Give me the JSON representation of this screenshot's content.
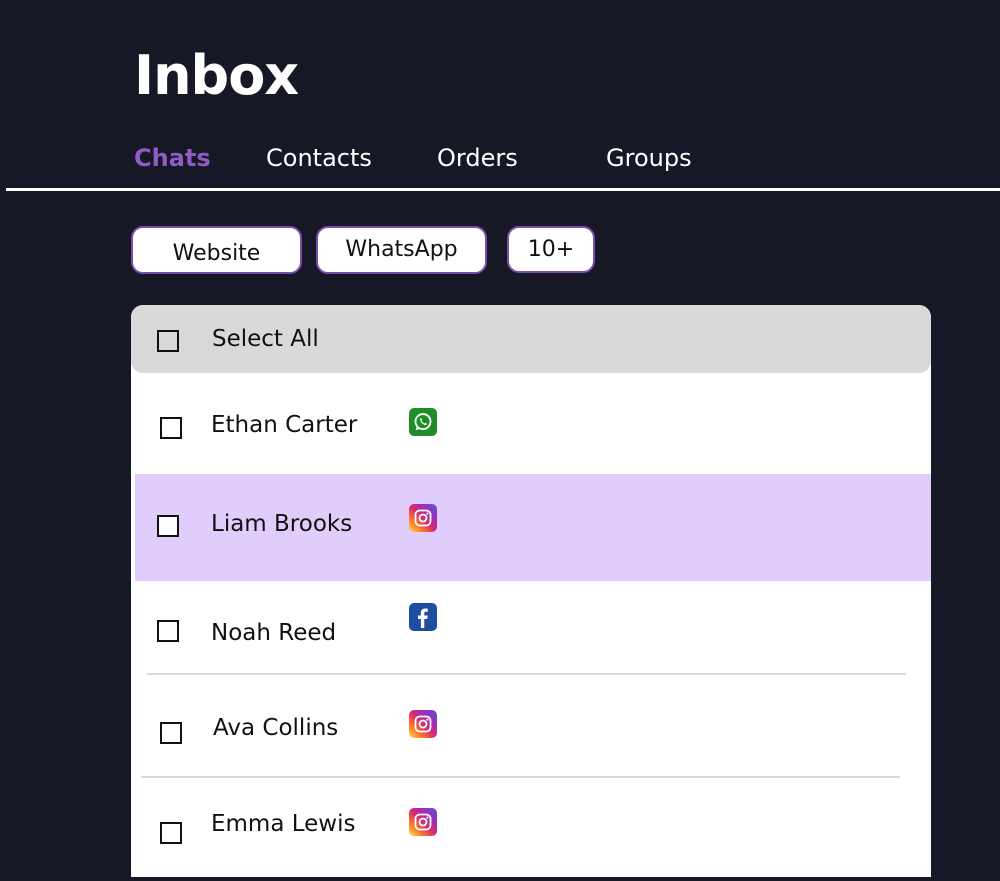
{
  "header": {
    "title": "Inbox"
  },
  "tabs": [
    {
      "label": "Chats",
      "active": true
    },
    {
      "label": "Contacts",
      "active": false
    },
    {
      "label": "Orders",
      "active": false
    },
    {
      "label": "Groups",
      "active": false
    }
  ],
  "filters": [
    {
      "label": "Website"
    },
    {
      "label": "WhatsApp"
    },
    {
      "label": "10+"
    }
  ],
  "list": {
    "select_all_label": "Select All",
    "select_all_checked": false,
    "rows": [
      {
        "name": "Ethan Carter",
        "channel_icon": "whatsapp-icon",
        "checked": false,
        "highlighted": false
      },
      {
        "name": "Liam Brooks",
        "channel_icon": "instagram-icon",
        "checked": false,
        "highlighted": true
      },
      {
        "name": "Noah Reed",
        "channel_icon": "facebook-icon",
        "checked": false,
        "highlighted": false
      },
      {
        "name": "Ava Collins",
        "channel_icon": "instagram-icon",
        "checked": false,
        "highlighted": false
      },
      {
        "name": "Emma Lewis",
        "channel_icon": "instagram-icon",
        "checked": false,
        "highlighted": false
      }
    ]
  },
  "colors": {
    "page_background": "#161826",
    "accent_purple": "#8f5cc6",
    "chip_border": "#7a4cab",
    "selected_row": "#e1cdfb",
    "select_all_background": "#d9d9d9"
  }
}
